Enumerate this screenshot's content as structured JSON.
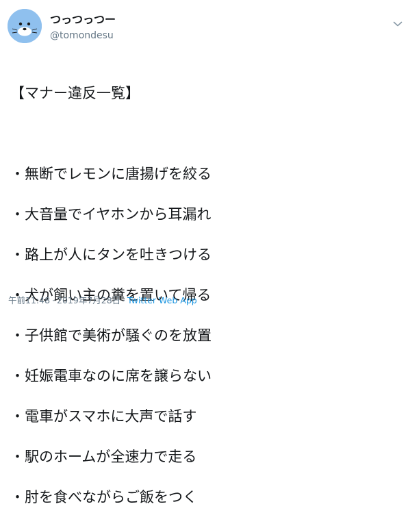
{
  "author": {
    "display_name": "つっつっつー",
    "handle": "@tomondesu"
  },
  "tweet": {
    "lines": [
      "【マナー違反一覧】",
      "",
      "・無断でレモンに唐揚げを絞る",
      "・大音量でイヤホンから耳漏れ",
      "・路上が人にタンを吐きつける",
      "・犬が飼い主の糞を置いて帰る",
      "・子供館で美術が騒ぐのを放置",
      "・妊娠電車なのに席を譲らない",
      "・電車がスマホに大声で話す",
      "・駅のホームが全速力で走る",
      "・肘を食べながらご飯をつく"
    ]
  },
  "meta": {
    "time": "午前11:48",
    "date": "2019年7月28日",
    "source": "Twitter Web App"
  },
  "icons": {
    "avatar": "seal-avatar",
    "menu": "chevron-down-icon"
  },
  "colors": {
    "avatar_bg": "#8fc0ee",
    "muted": "#657786",
    "link": "#1b95e0",
    "text": "#14171a"
  }
}
